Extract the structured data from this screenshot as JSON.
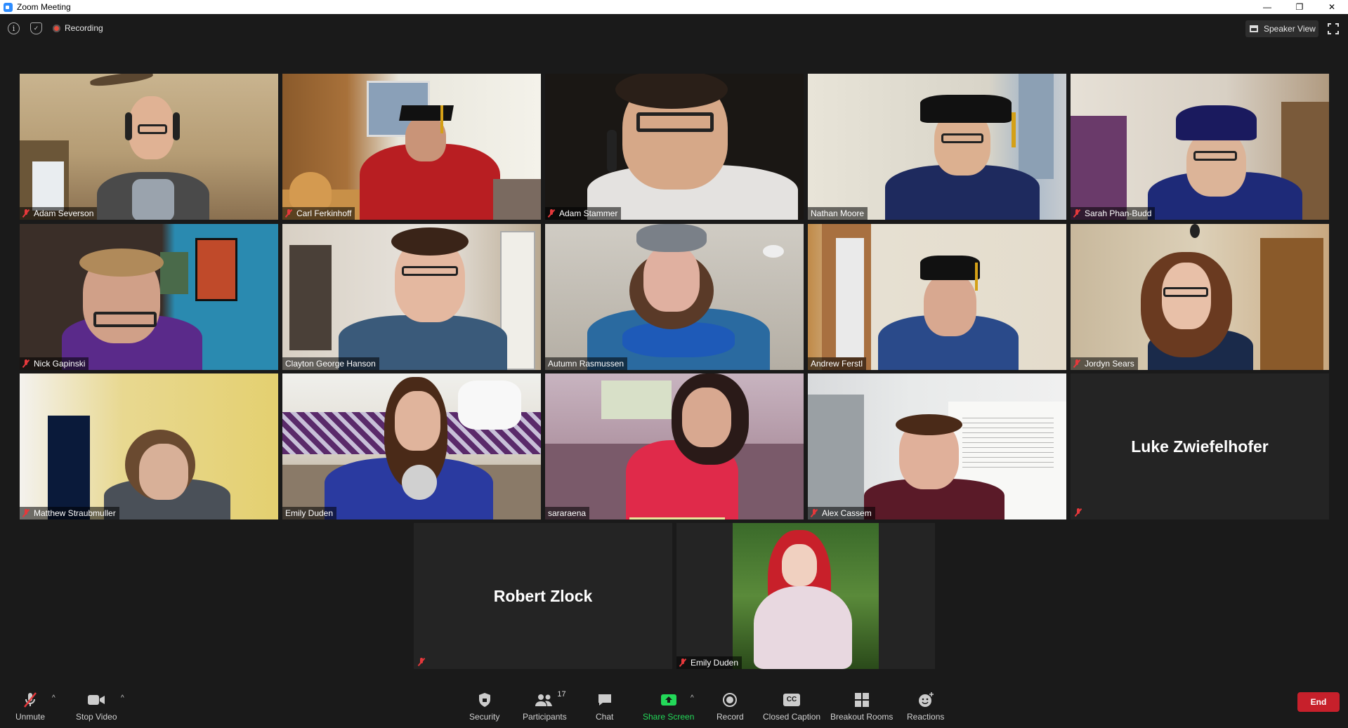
{
  "window": {
    "title": "Zoom Meeting",
    "minimize": "—",
    "restore": "❐",
    "close": "✕"
  },
  "topbar": {
    "recording_label": "Recording",
    "speaker_view_label": "Speaker View"
  },
  "participants": [
    {
      "name": "Adam Severson",
      "muted": true,
      "active": false
    },
    {
      "name": "Carl Ferkinhoff",
      "muted": true,
      "active": false
    },
    {
      "name": "Adam Stammer",
      "muted": true,
      "active": false
    },
    {
      "name": "Nathan Moore",
      "muted": false,
      "active": false
    },
    {
      "name": "Sarah Phan-Budd",
      "muted": true,
      "active": false
    },
    {
      "name": "Nick Gapinski",
      "muted": true,
      "active": false
    },
    {
      "name": "Clayton George Hanson",
      "muted": false,
      "active": false
    },
    {
      "name": "Autumn Rasmussen",
      "muted": false,
      "active": false
    },
    {
      "name": "Andrew Ferstl",
      "muted": false,
      "active": false
    },
    {
      "name": "Jordyn Sears",
      "muted": true,
      "active": false
    },
    {
      "name": "Matthew Straubmuller",
      "muted": true,
      "active": false
    },
    {
      "name": "Emily Duden",
      "muted": false,
      "active": true
    },
    {
      "name": "sararaena",
      "muted": false,
      "active": false
    },
    {
      "name": "Alex Cassem",
      "muted": true,
      "active": false
    },
    {
      "name": "Luke Zwiefelhofer",
      "muted": true,
      "video_off": true
    },
    {
      "name": "Robert Zlock",
      "muted": true,
      "video_off": true
    },
    {
      "name": "Emily Duden",
      "muted": true,
      "active": false
    }
  ],
  "toolbar": {
    "unmute": "Unmute",
    "stop_video": "Stop Video",
    "security": "Security",
    "participants": "Participants",
    "participants_count": "17",
    "chat": "Chat",
    "share_screen": "Share Screen",
    "record": "Record",
    "closed_caption": "Closed Caption",
    "cc_glyph": "CC",
    "breakout_rooms": "Breakout Rooms",
    "reactions": "Reactions",
    "end": "End"
  },
  "colors": {
    "share_green": "#23d959",
    "end_red": "#c7202b",
    "active_speaker": "#e8e49a",
    "muted_red": "#e5383b"
  }
}
